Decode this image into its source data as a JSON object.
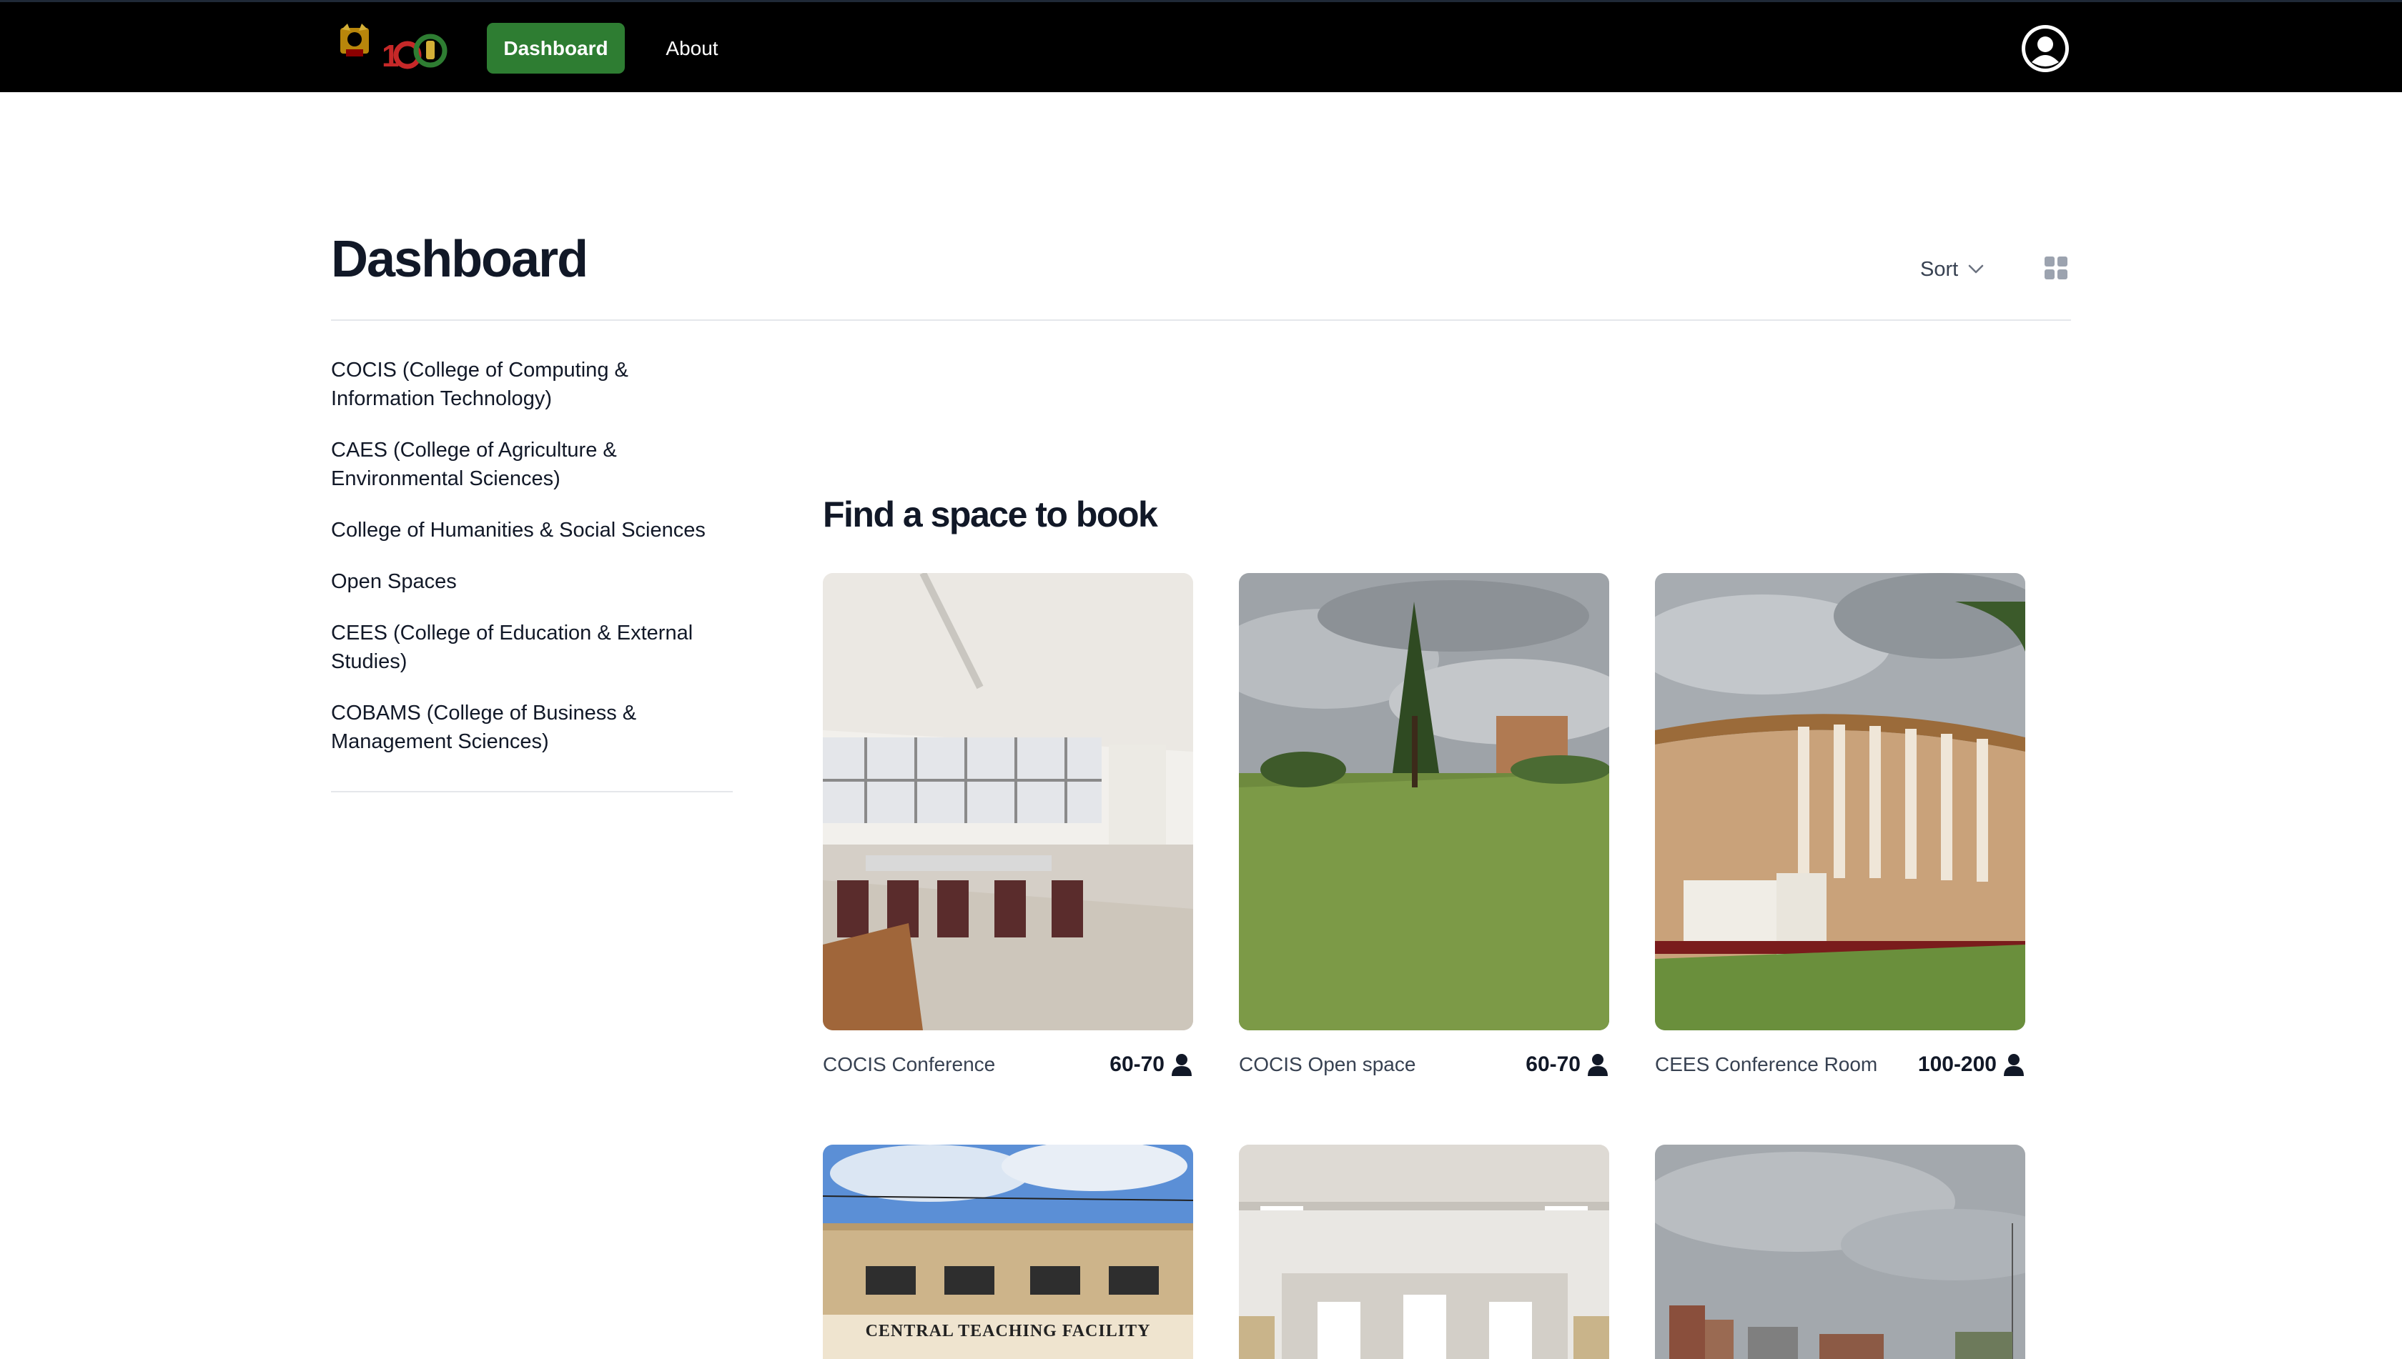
{
  "nav": {
    "logo_text": "100",
    "items": [
      {
        "label": "Dashboard",
        "active": true
      },
      {
        "label": "About",
        "active": false
      }
    ],
    "avatar_icon": "user-circle-icon",
    "accent": "#2e7d32"
  },
  "header": {
    "title": "Dashboard",
    "sort_label": "Sort",
    "sort_icon": "chevron-down-icon",
    "view_icon": "grid-view-icon"
  },
  "sidebar": {
    "items": [
      {
        "label": "COCIS (College of Computing & Information Technology)"
      },
      {
        "label": "CAES (College of Agriculture & Environmental Sciences)"
      },
      {
        "label": "College of Humanities & Social Sciences"
      },
      {
        "label": "Open Spaces"
      },
      {
        "label": "CEES (College of Education & External Studies)"
      },
      {
        "label": "COBAMS (College of Business & Management Sciences)"
      }
    ]
  },
  "main": {
    "section_title": "Find a space to book",
    "spaces": [
      {
        "name": "COCIS Conference",
        "capacity": "60-70",
        "image": "conference-room-photo"
      },
      {
        "name": "COCIS Open space",
        "capacity": "60-70",
        "image": "open-lawn-photo"
      },
      {
        "name": "CEES Conference Room",
        "capacity": "100-200",
        "image": "curved-building-photo"
      },
      {
        "name": "",
        "capacity": "",
        "image": "central-teaching-facility-photo",
        "sign_text": "CENTRAL TEACHING FACILITY"
      },
      {
        "name": "",
        "capacity": "",
        "image": "hall-interior-photo"
      },
      {
        "name": "",
        "capacity": "",
        "image": "cloudy-sky-photo"
      }
    ]
  }
}
